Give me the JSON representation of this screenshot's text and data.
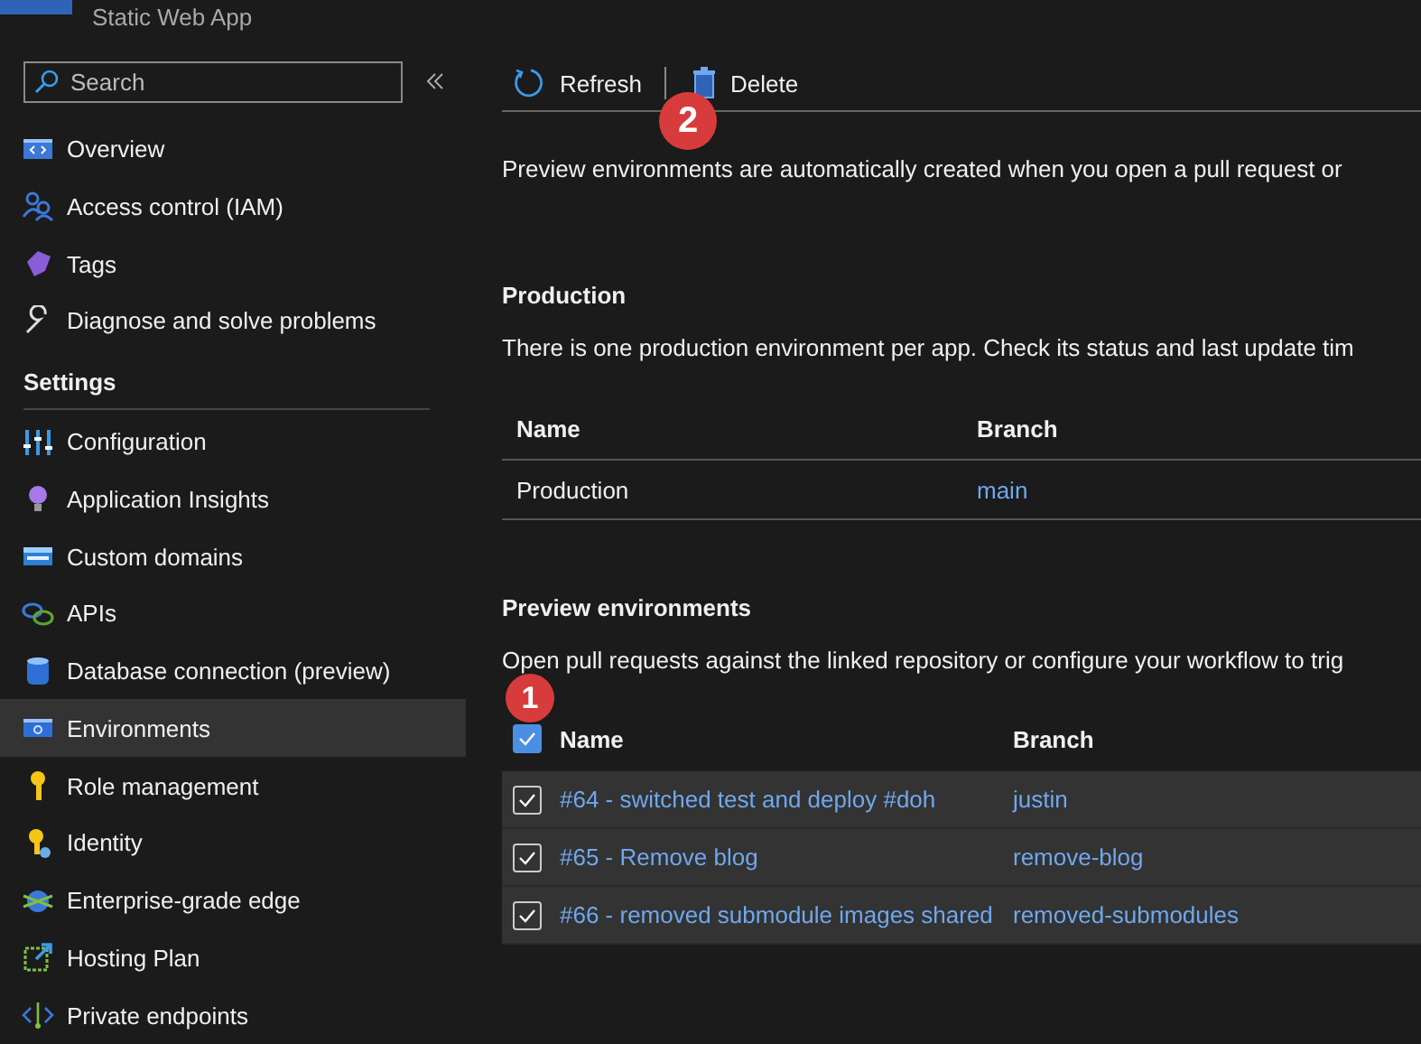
{
  "resource": {
    "subtitle": "Static Web App"
  },
  "search": {
    "placeholder": "Search"
  },
  "sidebar": {
    "items": [
      {
        "label": "Overview",
        "selected": false
      },
      {
        "label": "Access control (IAM)",
        "selected": false
      },
      {
        "label": "Tags",
        "selected": false
      },
      {
        "label": "Diagnose and solve problems",
        "selected": false
      }
    ],
    "sections": [
      {
        "title": "Settings",
        "items": [
          {
            "label": "Configuration",
            "selected": false
          },
          {
            "label": "Application Insights",
            "selected": false
          },
          {
            "label": "Custom domains",
            "selected": false
          },
          {
            "label": "APIs",
            "selected": false
          },
          {
            "label": "Database connection (preview)",
            "selected": false
          },
          {
            "label": "Environments",
            "selected": true
          },
          {
            "label": "Role management",
            "selected": false
          },
          {
            "label": "Identity",
            "selected": false
          },
          {
            "label": "Enterprise-grade edge",
            "selected": false
          },
          {
            "label": "Hosting Plan",
            "selected": false
          },
          {
            "label": "Private endpoints",
            "selected": false
          }
        ]
      }
    ]
  },
  "toolbar": [
    {
      "label": "Refresh"
    },
    {
      "label": "Delete"
    }
  ],
  "description": "Preview environments are automatically created when you open a pull request or",
  "production": {
    "title": "Production",
    "text": "There is one production environment per app. Check its status and last update tim",
    "columns": [
      "Name",
      "Branch"
    ],
    "rows": [
      {
        "name": "Production",
        "branch": "main"
      }
    ]
  },
  "preview": {
    "title": "Preview environments",
    "text": "Open pull requests against the linked repository or configure your workflow to trig",
    "columns": [
      "Name",
      "Branch"
    ],
    "all_checked": true,
    "rows": [
      {
        "name": "#64 - switched test and deploy #doh",
        "branch": "justin",
        "checked": true
      },
      {
        "name": "#65 - Remove blog",
        "branch": "remove-blog",
        "checked": true
      },
      {
        "name": "#66 - removed submodule images shared",
        "branch": "removed-submodules",
        "checked": true
      }
    ]
  },
  "annotations": [
    {
      "label": "2"
    },
    {
      "label": "1"
    }
  ]
}
